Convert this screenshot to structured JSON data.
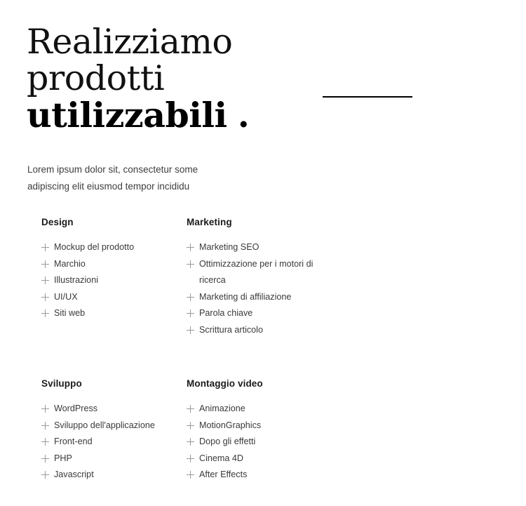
{
  "hero": {
    "title_line1": "Realizziamo",
    "title_line2": "prodotti",
    "title_emphasis": "utilizzabili",
    "title_dot": ".",
    "subtitle": "Lorem ipsum dolor sit, consectetur some\nadipiscing elit eiusmod tempor incididu"
  },
  "divider": {
    "color": "#000000"
  },
  "services": {
    "plus_icon": "plus-icon",
    "columns": [
      {
        "heading": "Design",
        "items": [
          "Mockup del prodotto",
          "Marchio",
          "Illustrazioni",
          "UI/UX",
          "Siti web"
        ]
      },
      {
        "heading": "Marketing",
        "items": [
          "Marketing SEO",
          "Ottimizzazione per i motori di ricerca",
          "Marketing di affiliazione",
          "Parola chiave",
          "Scrittura articolo"
        ]
      },
      {
        "heading": "Sviluppo",
        "items": [
          "WordPress",
          "Sviluppo dell'applicazione",
          "Front-end",
          "PHP",
          "Javascript"
        ]
      },
      {
        "heading": "Montaggio video",
        "items": [
          "Animazione",
          "MotionGraphics",
          "Dopo gli effetti",
          "Cinema 4D",
          "After Effects"
        ]
      }
    ]
  }
}
